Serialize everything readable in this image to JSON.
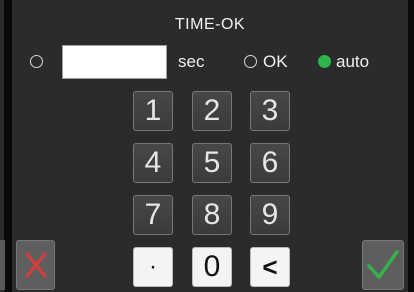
{
  "screen": {
    "title": "TIME-OK"
  },
  "time_field": {
    "value": "",
    "unit_label": "sec"
  },
  "mode_options": [
    {
      "label": "OK",
      "selected": false
    },
    {
      "label": "auto",
      "selected": true
    }
  ],
  "keypad": {
    "keys": [
      "1",
      "2",
      "3",
      "4",
      "5",
      "6",
      "7",
      "8",
      "9",
      "·",
      "0",
      "<"
    ]
  },
  "actions": {
    "cancel_icon": "x-icon",
    "confirm_icon": "check-icon"
  },
  "colors": {
    "selected_radio": "#2db54a",
    "cancel": "#d73c3c",
    "confirm": "#35b34a"
  }
}
